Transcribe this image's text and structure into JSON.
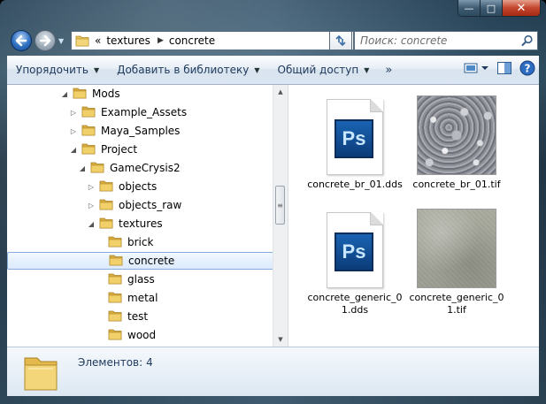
{
  "caption_buttons": {
    "minimize": "—",
    "maximize": "□",
    "close": "✕"
  },
  "address": {
    "overflow": "«",
    "path": [
      "textures",
      "concrete"
    ]
  },
  "search": {
    "placeholder": "Поиск: concrete"
  },
  "toolbar": {
    "organize": "Упорядочить",
    "add_library": "Добавить в библиотеку",
    "share": "Общий доступ",
    "more": "»"
  },
  "tree": [
    {
      "label": "Mods",
      "expanded": true
    },
    {
      "label": "Example_Assets",
      "expanded": false
    },
    {
      "label": "Maya_Samples",
      "expanded": false
    },
    {
      "label": "Project",
      "expanded": true
    },
    {
      "label": "GameCrysis2",
      "expanded": true
    },
    {
      "label": "objects",
      "expanded": false
    },
    {
      "label": "objects_raw",
      "expanded": false
    },
    {
      "label": "textures",
      "expanded": true
    },
    {
      "label": "brick"
    },
    {
      "label": "concrete",
      "selected": true
    },
    {
      "label": "glass"
    },
    {
      "label": "metal"
    },
    {
      "label": "test"
    },
    {
      "label": "wood"
    }
  ],
  "files": [
    {
      "name": "concrete_br_01.dds",
      "type": "photoshop-icon",
      "icon_text": "Ps"
    },
    {
      "name": "concrete_br_01.tif",
      "type": "gravel-texture"
    },
    {
      "name": "concrete_generic_01.dds",
      "type": "photoshop-icon",
      "icon_text": "Ps"
    },
    {
      "name": "concrete_generic_01.tif",
      "type": "concrete-texture"
    }
  ],
  "details": {
    "count_label": "Элементов:",
    "count_value": "4"
  },
  "colors": {
    "accent": "#1e395b",
    "selection_border": "#84acdd",
    "folder": "#e8c25a"
  }
}
